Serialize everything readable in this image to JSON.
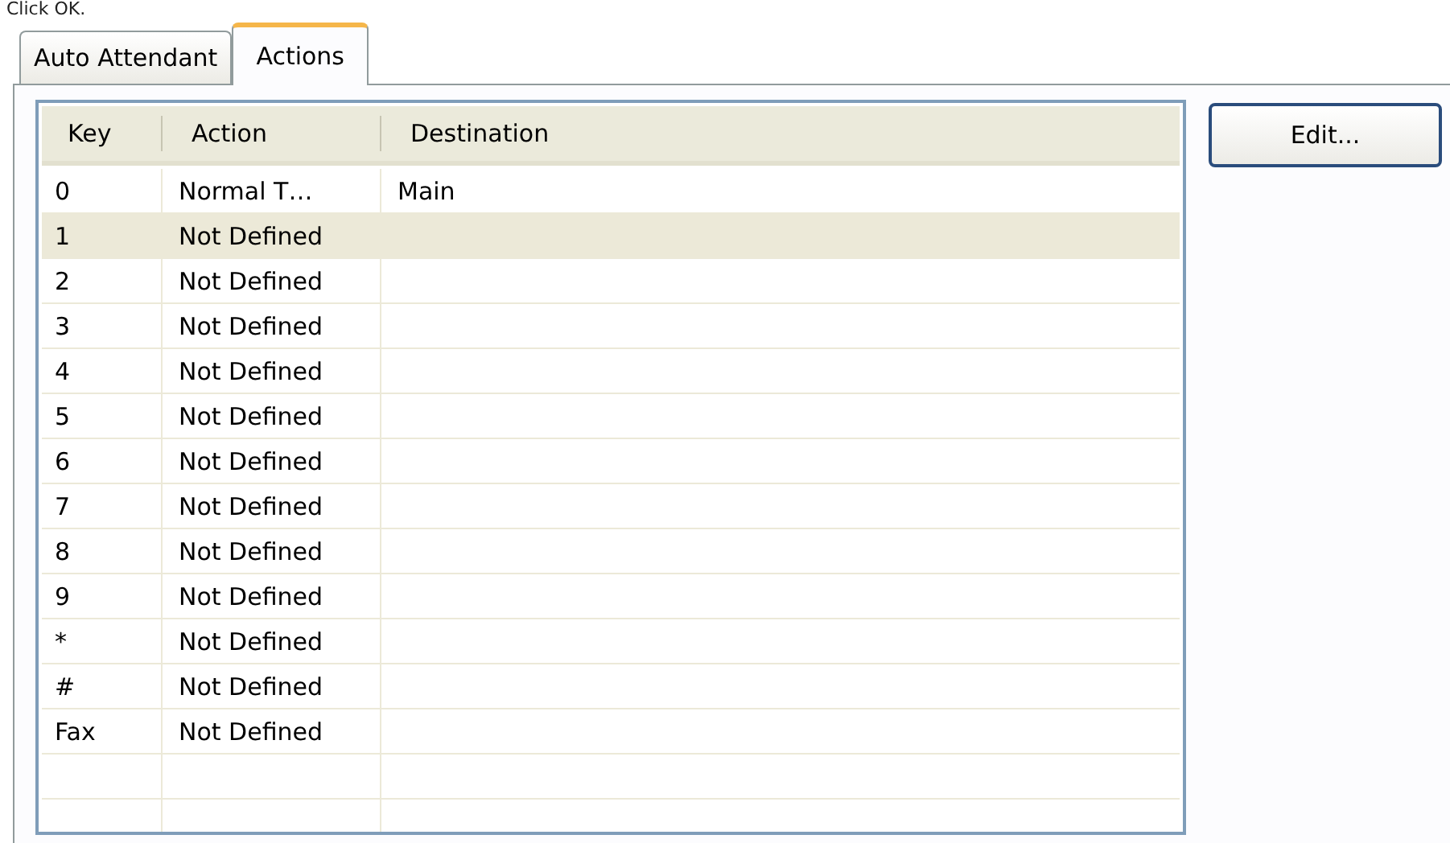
{
  "instruction": "Click OK.",
  "tabs": [
    {
      "label": "Auto Attendant",
      "selected": false
    },
    {
      "label": "Actions",
      "selected": true
    }
  ],
  "table": {
    "columns": [
      "Key",
      "Action",
      "Destination"
    ],
    "rows": [
      {
        "key": "0",
        "action": "Normal T…",
        "destination": "Main",
        "selected": false
      },
      {
        "key": "1",
        "action": "Not Defined",
        "selected": true
      },
      {
        "key": "2",
        "action": "Not Defined",
        "selected": false
      },
      {
        "key": "3",
        "action": "Not Defined",
        "selected": false
      },
      {
        "key": "4",
        "action": "Not Defined",
        "selected": false
      },
      {
        "key": "5",
        "action": "Not Defined",
        "selected": false
      },
      {
        "key": "6",
        "action": "Not Defined",
        "selected": false
      },
      {
        "key": "7",
        "action": "Not Defined",
        "selected": false
      },
      {
        "key": "8",
        "action": "Not Defined",
        "selected": false
      },
      {
        "key": "9",
        "action": "Not Defined",
        "selected": false
      },
      {
        "key": "*",
        "action": "Not Defined",
        "selected": false
      },
      {
        "key": "#",
        "action": "Not Defined",
        "selected": false
      },
      {
        "key": "Fax",
        "action": "Not Defined",
        "selected": false
      }
    ]
  },
  "buttons": [
    "Edit..."
  ]
}
